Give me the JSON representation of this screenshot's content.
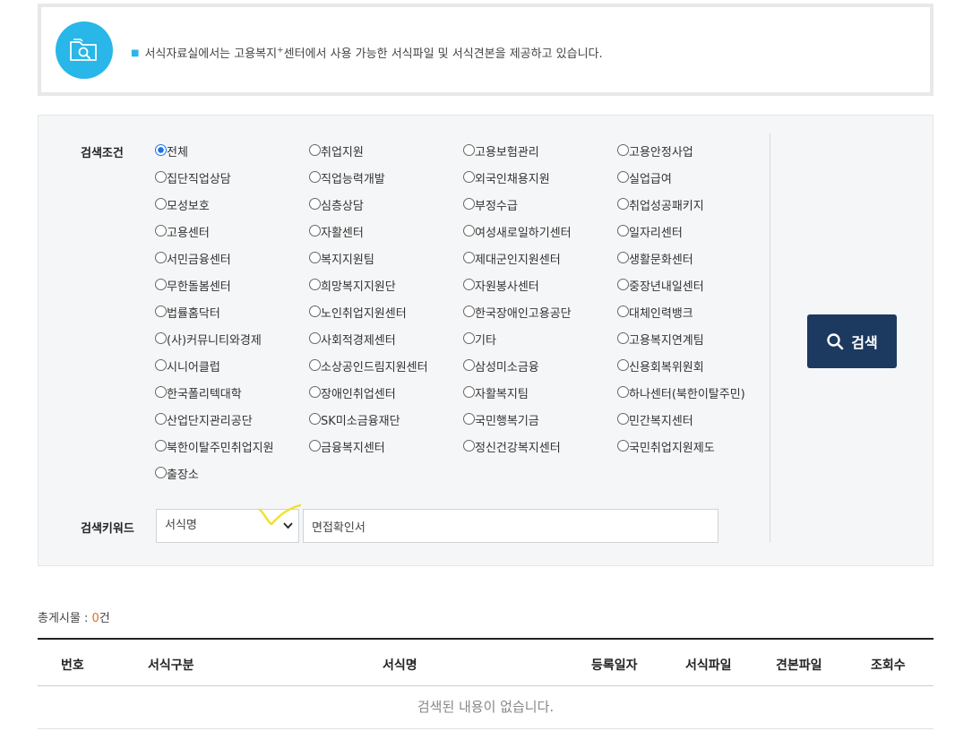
{
  "info": {
    "text_before": "서식자료실에서는 고용복지",
    "text_sup": "+",
    "text_after": "센터에서 사용 가능한 서식파일 및 서식견본을 제공하고 있습니다."
  },
  "search": {
    "condition_label": "검색조건",
    "keyword_label": "검색키워드",
    "options": [
      "전체",
      "취업지원",
      "고용보험관리",
      "고용안정사업",
      "집단직업상담",
      "직업능력개발",
      "외국인채용지원",
      "실업급여",
      "모성보호",
      "심층상담",
      "부정수급",
      "취업성공패키지",
      "고용센터",
      "자활센터",
      "여성새로일하기센터",
      "일자리센터",
      "서민금융센터",
      "복지지원팀",
      "제대군인지원센터",
      "생활문화센터",
      "무한돌봄센터",
      "희망복지지원단",
      "자원봉사센터",
      "중장년내일센터",
      "법률홈닥터",
      "노인취업지원센터",
      "한국장애인고용공단",
      "대체인력뱅크",
      "(사)커뮤니티와경제",
      "사회적경제센터",
      "기타",
      "고용복지연계팀",
      "시니어클럽",
      "소상공인드림지원센터",
      "삼성미소금융",
      "신용회복위원회",
      "한국폴리텍대학",
      "장애인취업센터",
      "자활복지팀",
      "하나센터(북한이탈주민)",
      "산업단지관리공단",
      "SK미소금융재단",
      "국민행복기금",
      "민간복지센터",
      "북한이탈주민취업지원",
      "금융복지센터",
      "정신건강복지센터",
      "국민취업지원제도",
      "출장소"
    ],
    "selected_option": "전체",
    "keyword_type": "서식명",
    "keyword_value": "면접확인서",
    "button_label": "검색"
  },
  "results": {
    "total_label": "총게시물 : ",
    "total_count": "0",
    "total_unit": "건",
    "columns": [
      "번호",
      "서식구분",
      "서식명",
      "등록일자",
      "서식파일",
      "견본파일",
      "조회수"
    ],
    "empty_message": "검색된 내용이 없습니다."
  },
  "colors": {
    "accent": "#29b6e8",
    "button": "#1c3960",
    "count": "#e66a1e"
  }
}
